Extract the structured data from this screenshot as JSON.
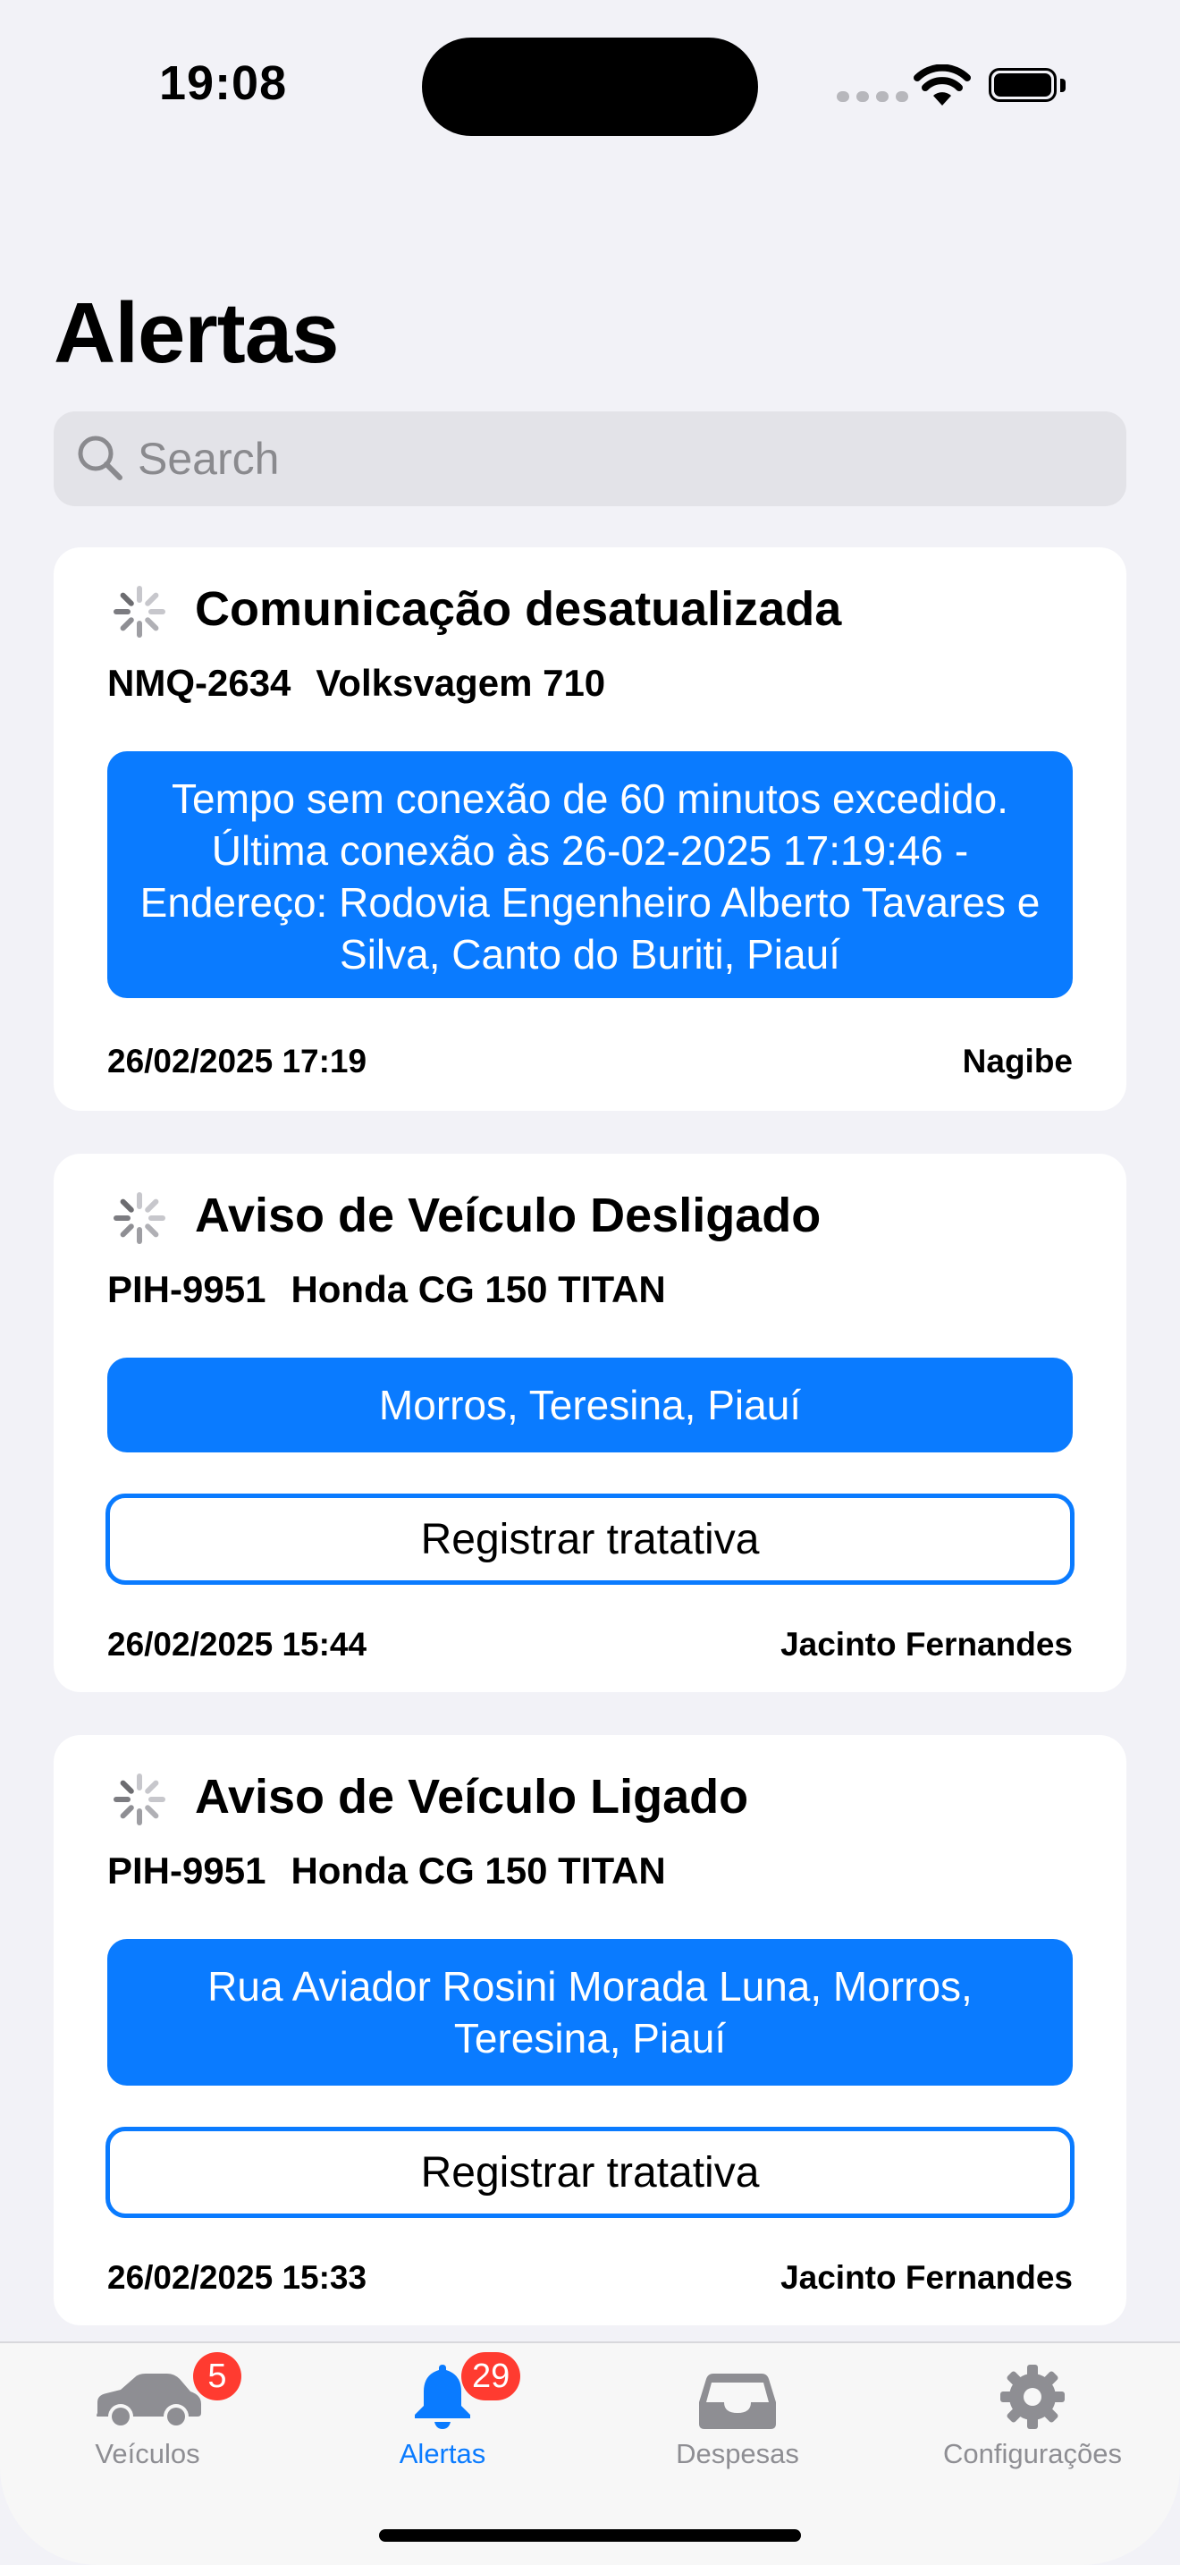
{
  "status_bar": {
    "time": "19:08"
  },
  "page": {
    "title": "Alertas"
  },
  "search": {
    "placeholder": "Search"
  },
  "alerts": [
    {
      "title": "Comunicação desatualizada",
      "plate": "NMQ-2634",
      "model": "Volksvagem 710",
      "message": "Tempo sem conexão de 60 minutos excedido. Última conexão às 26-02-2025 17:19:46 - Endereço: Rodovia Engenheiro Alberto Tavares e Silva, Canto do Buriti, Piauí",
      "date": "26/02/2025 17:19",
      "user": "Nagibe"
    },
    {
      "title": "Aviso de Veículo Desligado",
      "plate": "PIH-9951",
      "model": "Honda CG 150 TITAN",
      "message": "Morros, Teresina, Piauí",
      "action_label": "Registrar tratativa",
      "date": "26/02/2025 15:44",
      "user": "Jacinto Fernandes"
    },
    {
      "title": "Aviso de Veículo Ligado",
      "plate": "PIH-9951",
      "model": "Honda CG 150 TITAN",
      "message": "Rua Aviador Rosini Morada Luna, Morros, Teresina, Piauí",
      "action_label": "Registrar tratativa",
      "date": "26/02/2025 15:33",
      "user": "Jacinto Fernandes"
    }
  ],
  "tabbar": {
    "tabs": [
      {
        "label": "Veículos",
        "icon": "car-icon",
        "badge": "5"
      },
      {
        "label": "Alertas",
        "icon": "bell-icon",
        "badge": "29",
        "active": true
      },
      {
        "label": "Despesas",
        "icon": "tray-icon"
      },
      {
        "label": "Configurações",
        "icon": "gear-icon"
      }
    ]
  },
  "colors": {
    "accent": "#0a7bff",
    "badge": "#ff3b30",
    "background": "#f2f2f7"
  }
}
